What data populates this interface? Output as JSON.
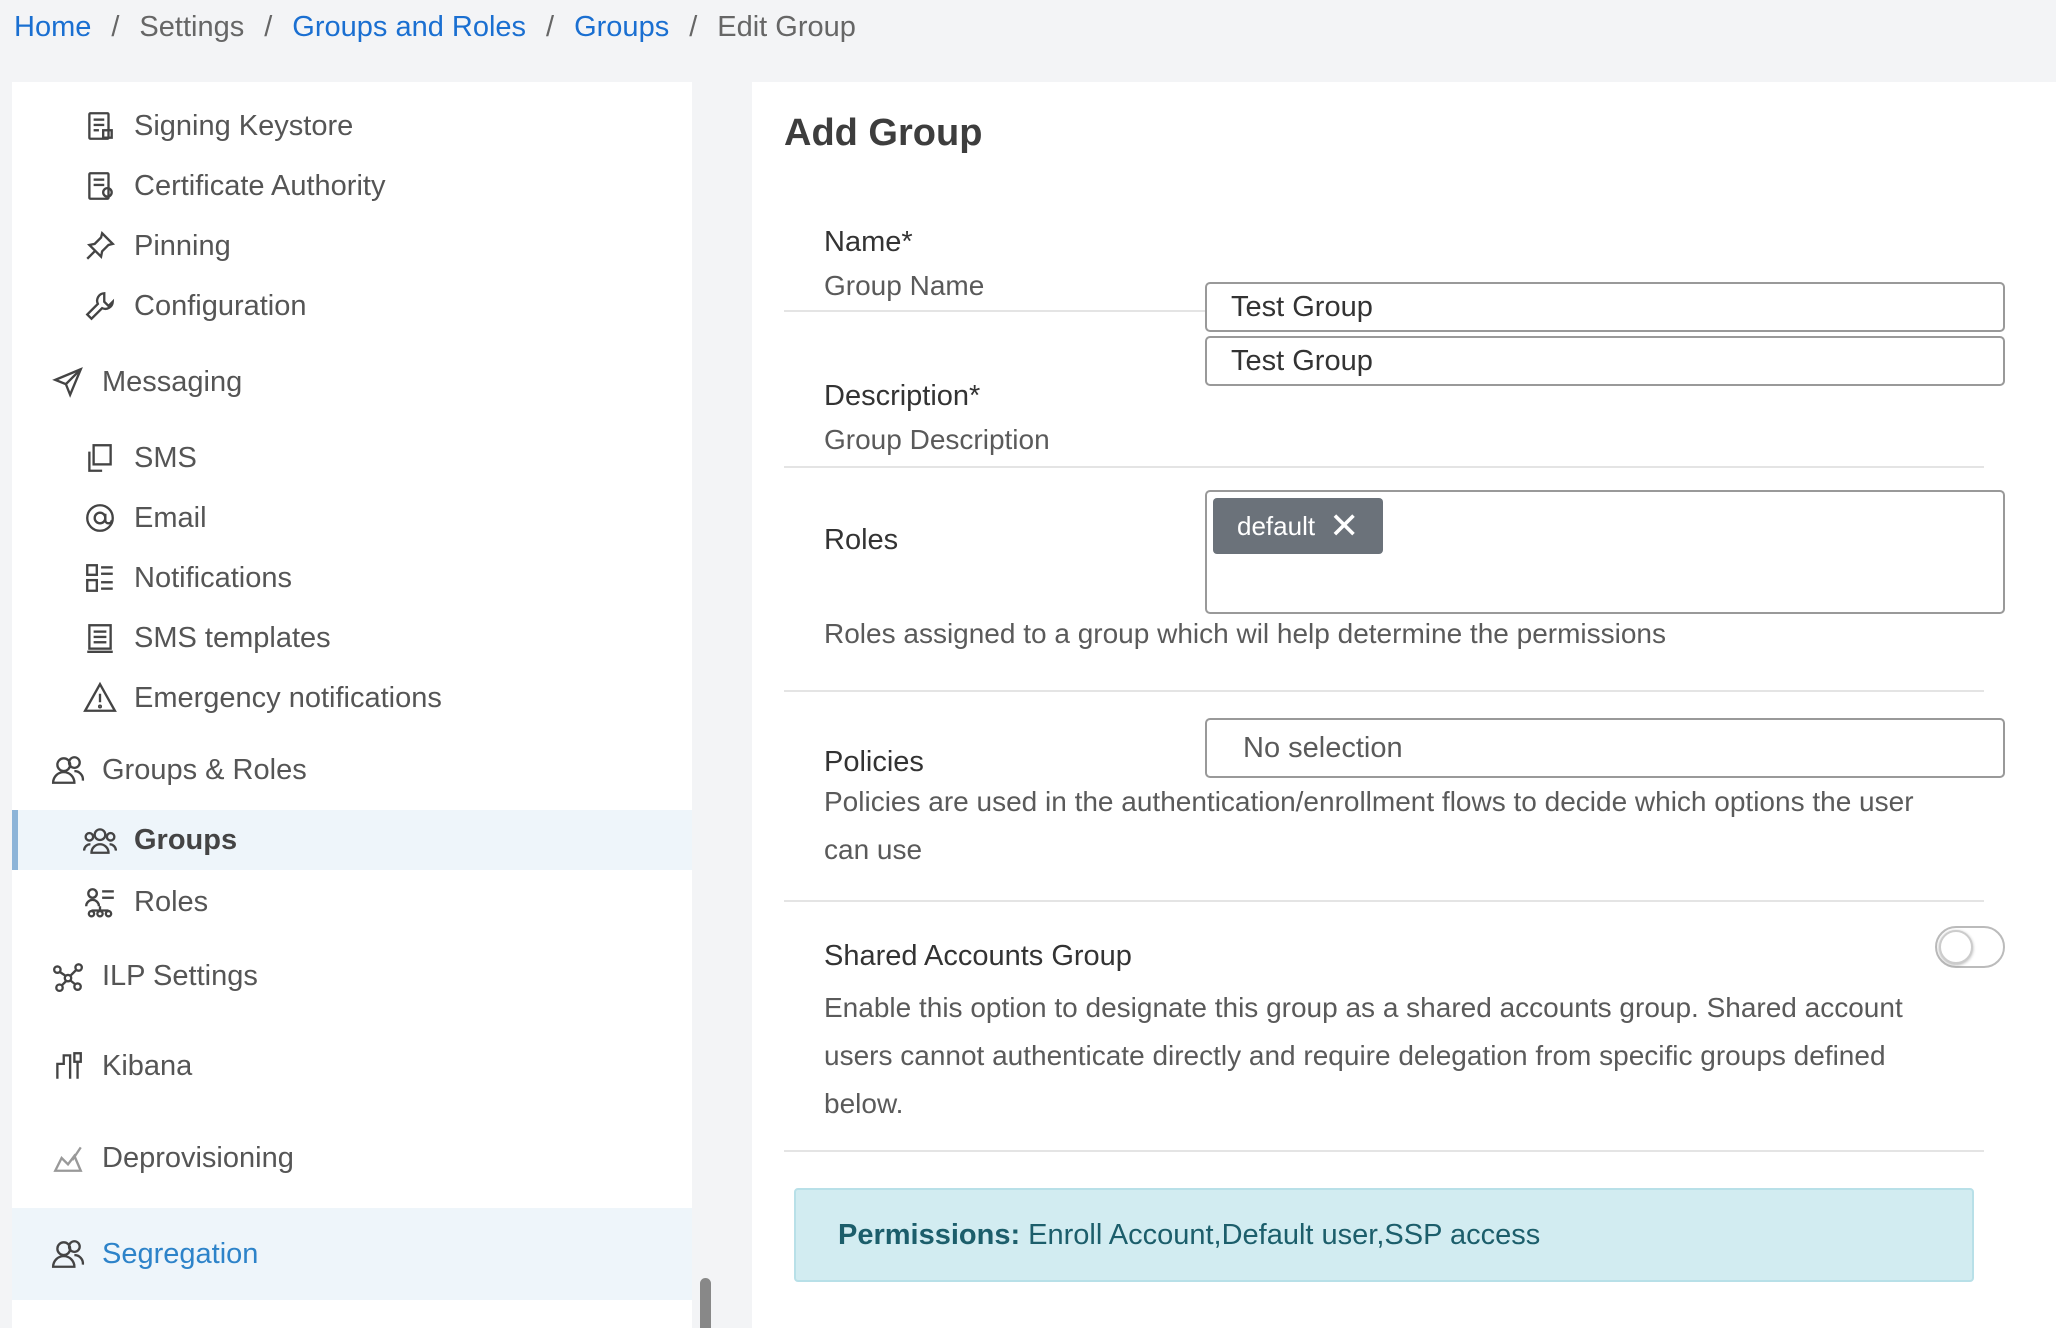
{
  "breadcrumb": {
    "home": "Home",
    "settings": "Settings",
    "groups_roles": "Groups and Roles",
    "groups": "Groups",
    "current": "Edit Group",
    "sep": "/"
  },
  "sidebar": {
    "items": [
      {
        "label": "Signing Keystore",
        "icon": "keystore-icon"
      },
      {
        "label": "Certificate Authority",
        "icon": "certificate-icon"
      },
      {
        "label": "Pinning",
        "icon": "pin-icon"
      },
      {
        "label": "Configuration",
        "icon": "wrench-icon"
      },
      {
        "label": "Messaging",
        "icon": "paper-plane-icon"
      },
      {
        "label": "SMS",
        "icon": "sms-icon"
      },
      {
        "label": "Email",
        "icon": "at-icon"
      },
      {
        "label": "Notifications",
        "icon": "notifications-list-icon"
      },
      {
        "label": "SMS templates",
        "icon": "template-icon"
      },
      {
        "label": "Emergency notifications",
        "icon": "warning-triangle-icon"
      },
      {
        "label": "Groups & Roles",
        "icon": "users-icon"
      },
      {
        "label": "Groups",
        "icon": "group-icon"
      },
      {
        "label": "Roles",
        "icon": "roles-icon"
      },
      {
        "label": "ILP Settings",
        "icon": "ilp-icon"
      },
      {
        "label": "Kibana",
        "icon": "kibana-icon"
      },
      {
        "label": "Deprovisioning",
        "icon": "deprovision-icon"
      },
      {
        "label": "Segregation",
        "icon": "users-icon"
      }
    ]
  },
  "form": {
    "title": "Add Group",
    "name": {
      "label": "Name*",
      "help": "Group Name",
      "value": "Test Group"
    },
    "description": {
      "label": "Description*",
      "help": "Group Description",
      "value": "Test Group"
    },
    "roles": {
      "label": "Roles",
      "help": "Roles assigned to a group which wil help determine the permissions",
      "tags": [
        "default"
      ],
      "remove_glyph": "✕"
    },
    "policies": {
      "label": "Policies",
      "placeholder": "No selection",
      "help_line1": "Policies are used in the authentication/enrollment flows to decide which options the user",
      "help_line2": "can use"
    },
    "shared": {
      "label": "Shared Accounts Group",
      "enabled": false,
      "help_line1": "Enable this option to designate this group as a shared accounts group. Shared account",
      "help_line2": "users cannot authenticate directly and require delegation from specific groups defined",
      "help_line3": "below."
    }
  },
  "permissions": {
    "label": "Permissions:",
    "value": "Enroll Account,Default user,SSP access"
  },
  "colors": {
    "link": "#1a6fd1",
    "alert_bg": "#d2ecf1",
    "tag_bg": "#6b727a",
    "active_bg": "#eef5fa"
  }
}
